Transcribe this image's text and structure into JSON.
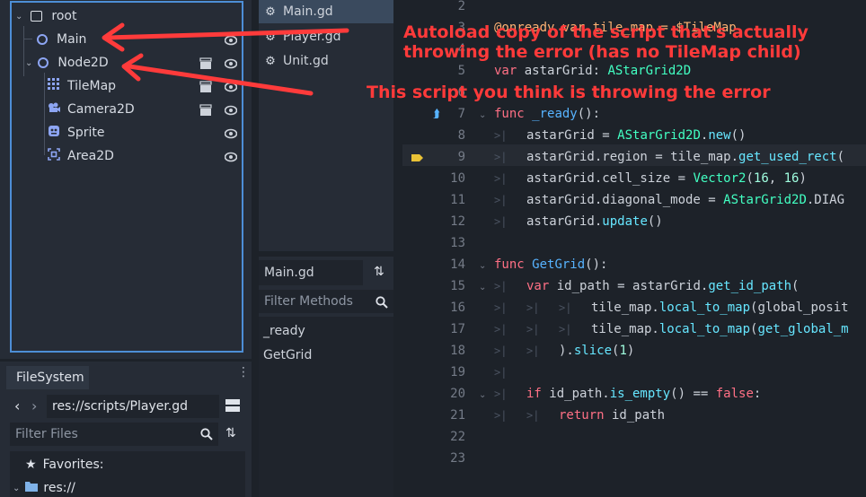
{
  "scene_tree": {
    "items": [
      {
        "label": "root",
        "icon": "node-root-icon"
      },
      {
        "label": "Main",
        "icon": "node-circle-icon"
      },
      {
        "label": "Node2D",
        "icon": "node-circle-icon"
      },
      {
        "label": "TileMap",
        "icon": "tilemap-icon"
      },
      {
        "label": "Camera2D",
        "icon": "camera-icon"
      },
      {
        "label": "Sprite",
        "icon": "sprite-icon"
      },
      {
        "label": "Area2D",
        "icon": "area-icon"
      }
    ]
  },
  "filesystem": {
    "tab_label": "FileSystem",
    "path": "res://scripts/Player.gd",
    "filter_placeholder": "Filter Files",
    "favorites_label": "Favorites:",
    "res_label": "res://"
  },
  "scripts": {
    "items": [
      "Main.gd",
      "Player.gd",
      "Unit.gd"
    ],
    "selected": "Main.gd"
  },
  "methods": {
    "title": "Main.gd",
    "filter_placeholder": "Filter Methods",
    "items": [
      "_ready",
      "GetGrid"
    ]
  },
  "editor": {
    "line_numbers": [
      "2",
      "3",
      "4",
      "5",
      "6",
      "7",
      "8",
      "9",
      "10",
      "11",
      "12",
      "13",
      "14",
      "15",
      "16",
      "17",
      "18",
      "19",
      "20",
      "21",
      "22",
      "23"
    ],
    "lines": [
      "",
      "@onready var tile_map = $TileMap",
      "",
      "var astarGrid: AStarGrid2D",
      "",
      "func _ready():",
      "astarGrid = AStarGrid2D.new()",
      "astarGrid.region = tile_map.get_used_rect(",
      "astarGrid.cell_size = Vector2(16, 16)",
      "astarGrid.diagonal_mode = AStarGrid2D.DIAG",
      "astarGrid.update()",
      "",
      "func GetGrid():",
      "var id_path = astarGrid.get_id_path(",
      "tile_map.local_to_map(global_posit",
      "tile_map.local_to_map(get_global_m",
      ").slice(1)",
      "",
      "if id_path.is_empty() == false:",
      "return id_path",
      "",
      ""
    ]
  },
  "annotations": {
    "autoload_note": "Autoload copy of the script that's actually throwing the error (has no TileMap child)",
    "script_note": "This script you think is throwing the error"
  },
  "colors": {
    "accent": "#4d8ed6",
    "annotation": "#ff3a3a",
    "keyword": "#ff7085",
    "type": "#42ffc2",
    "function": "#57b3ff"
  }
}
